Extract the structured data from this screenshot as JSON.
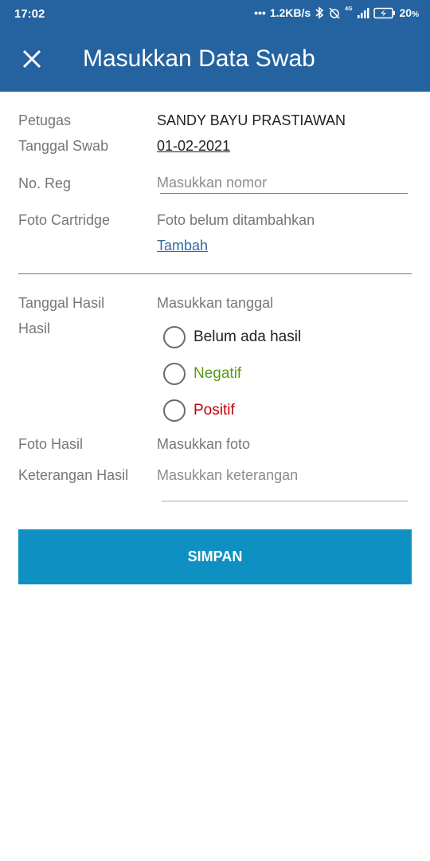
{
  "status_bar": {
    "time": "17:02",
    "network_speed": "1.2KB/s",
    "battery": "20",
    "battery_unit": "%",
    "network_type": "4G",
    "icons": [
      "bluetooth-icon",
      "alarm-off-icon",
      "signal-icon",
      "battery-charging-icon"
    ]
  },
  "app_bar": {
    "title": "Masukkan Data Swab",
    "close_icon": "close-icon"
  },
  "form": {
    "petugas": {
      "label": "Petugas",
      "value": "SANDY BAYU PRASTIAWAN"
    },
    "tanggal_swab": {
      "label": "Tanggal Swab",
      "value": "01-02-2021"
    },
    "no_reg": {
      "label": "No. Reg",
      "placeholder": "Masukkan nomor"
    },
    "foto_cartridge": {
      "label": "Foto Cartridge",
      "status": "Foto belum ditambahkan",
      "action": "Tambah"
    },
    "tanggal_hasil": {
      "label": "Tanggal Hasil",
      "placeholder": "Masukkan tanggal"
    },
    "hasil": {
      "label": "Hasil",
      "options": [
        {
          "label": "Belum ada hasil",
          "color": "#222222",
          "selected": false
        },
        {
          "label": "Negatif",
          "color": "#5a9a12",
          "selected": false
        },
        {
          "label": "Positif",
          "color": "#c0000b",
          "selected": false
        }
      ]
    },
    "foto_hasil": {
      "label": "Foto Hasil",
      "placeholder": "Masukkan foto"
    },
    "keterangan_hasil": {
      "label": "Keterangan Hasil",
      "placeholder": "Masukkan keterangan"
    }
  },
  "actions": {
    "save_label": "SIMPAN"
  },
  "colors": {
    "app_bar": "#2463a0",
    "button": "#0e91c2",
    "link": "#2f6aa3"
  }
}
